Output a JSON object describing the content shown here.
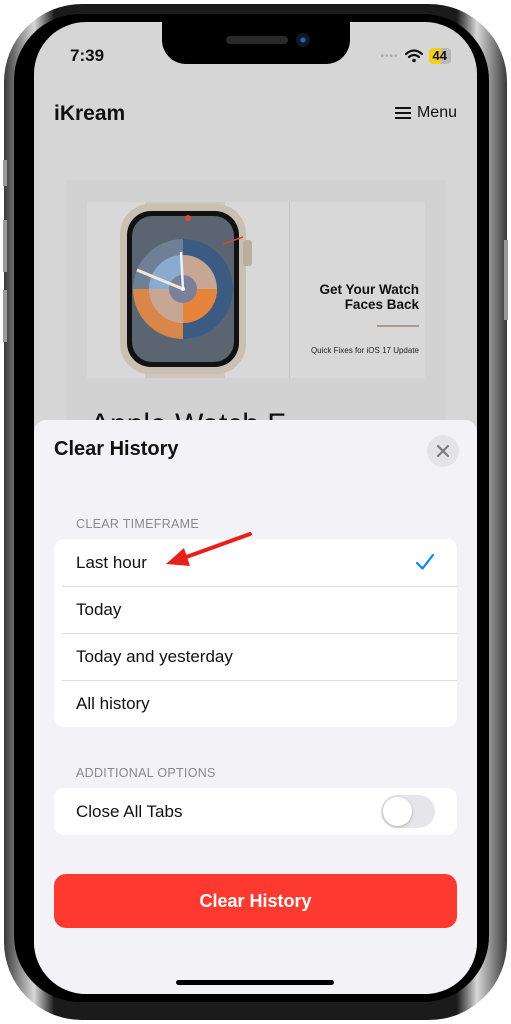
{
  "status_bar": {
    "time": "7:39",
    "battery": "44",
    "icons": [
      "signal-dots-icon",
      "wifi-icon",
      "battery-icon"
    ]
  },
  "site": {
    "logo": "iKream",
    "menu_label": "Menu",
    "menu_icon": "hamburger-icon"
  },
  "hero": {
    "title_line1": "Get Your Watch",
    "title_line2": "Faces Back",
    "subtitle": "Quick Fixes for iOS 17 Update"
  },
  "article": {
    "partial_title": "Apple Watch F"
  },
  "sheet": {
    "title": "Clear History",
    "close_icon": "close-icon",
    "timeframe": {
      "label": "CLEAR TIMEFRAME",
      "options": [
        {
          "label": "Last hour",
          "selected": true
        },
        {
          "label": "Today",
          "selected": false
        },
        {
          "label": "Today and yesterday",
          "selected": false
        },
        {
          "label": "All history",
          "selected": false
        }
      ]
    },
    "additional": {
      "label": "ADDITIONAL OPTIONS",
      "close_all_tabs_label": "Close All Tabs",
      "close_all_tabs_on": false
    },
    "clear_button_label": "Clear History"
  },
  "colors": {
    "accent_blue": "#0a84ff",
    "destructive_red": "#fe3a30",
    "annotation_red": "#e8201a"
  }
}
